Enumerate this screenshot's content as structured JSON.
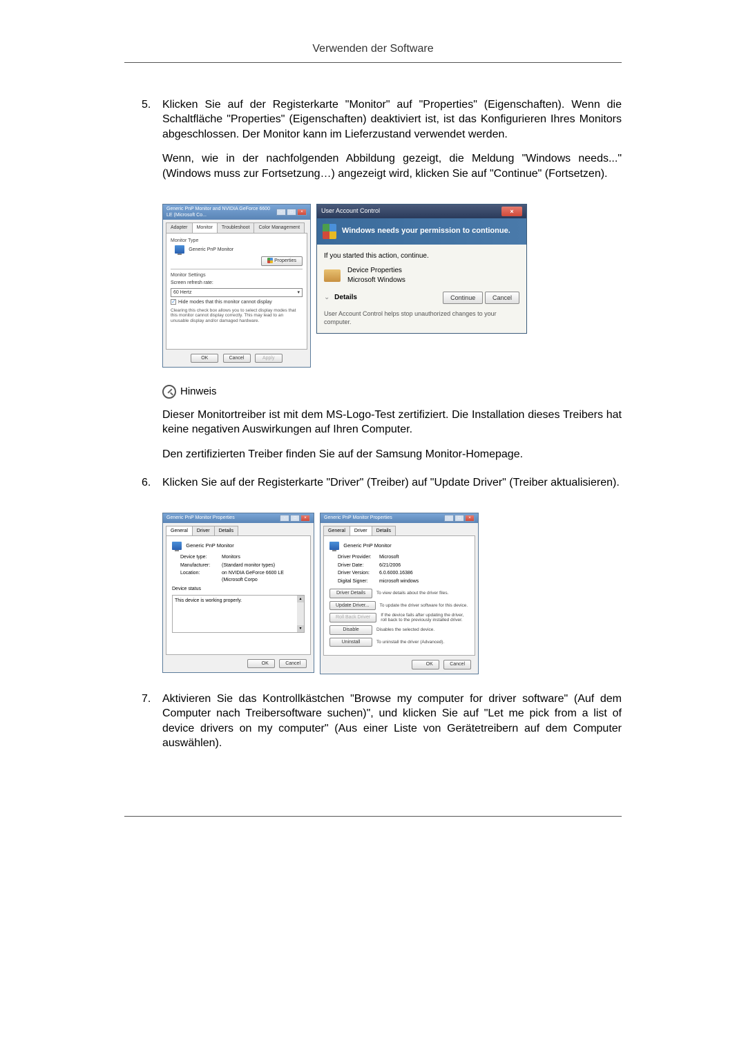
{
  "header": {
    "title": "Verwenden der Software"
  },
  "step5": {
    "number": "5.",
    "para1": "Klicken Sie auf der Registerkarte \"Monitor\" auf \"Properties\" (Eigenschaften). Wenn die Schaltfläche \"Properties\" (Eigenschaften) deaktiviert ist, ist das Konfigurieren Ihres Monitors abgeschlossen. Der Monitor kann im Lieferzustand verwendet werden.",
    "para2": "Wenn, wie in der nachfolgenden Abbildung gezeigt, die Meldung \"Windows needs...\" (Windows muss zur Fortsetzung…) angezeigt wird, klicken Sie auf \"Continue\" (Fortsetzen)."
  },
  "monitor_dialog": {
    "title": "Generic PnP Monitor and NVIDIA GeForce 6600 LE (Microsoft Co...",
    "tabs": {
      "adapter": "Adapter",
      "monitor": "Monitor",
      "troubleshoot": "Troubleshoot",
      "color": "Color Management"
    },
    "type_label": "Monitor Type",
    "type_value": "Generic PnP Monitor",
    "properties_btn": "Properties",
    "settings_label": "Monitor Settings",
    "refresh_label": "Screen refresh rate:",
    "refresh_value": "60 Hertz",
    "hide_modes": "Hide modes that this monitor cannot display",
    "hide_desc": "Clearing this check box allows you to select display modes that this monitor cannot display correctly. This may lead to an unusable display and/or damaged hardware.",
    "ok": "OK",
    "cancel": "Cancel",
    "apply": "Apply"
  },
  "uac": {
    "title": "User Account Control",
    "banner": "Windows needs your permission to contionue.",
    "subtext": "If you started this action, continue.",
    "prog_name": "Device Properties",
    "prog_pub": "Microsoft Windows",
    "details": "Details",
    "continue": "Continue",
    "cancel": "Cancel",
    "footer": "User Account Control helps stop unauthorized changes to your computer."
  },
  "note": {
    "title": "Hinweis",
    "para1": "Dieser Monitortreiber ist mit dem MS-Logo-Test zertifiziert. Die Installation dieses Treibers hat keine negativen Auswirkungen auf Ihren Computer.",
    "para2": "Den zertifizierten Treiber finden Sie auf der Samsung Monitor-Homepage."
  },
  "step6": {
    "number": "6.",
    "para1": "Klicken Sie auf der Registerkarte \"Driver\" (Treiber) auf \"Update Driver\" (Treiber aktualisieren)."
  },
  "gen_dialog": {
    "title": "Generic PnP Monitor Properties",
    "tabs": {
      "general": "General",
      "driver": "Driver",
      "details": "Details"
    },
    "name": "Generic PnP Monitor",
    "dtype_l": "Device type:",
    "dtype_v": "Monitors",
    "manu_l": "Manufacturer:",
    "manu_v": "(Standard monitor types)",
    "loc_l": "Location:",
    "loc_v": "on NVIDIA GeForce 6600 LE (Microsoft Corpo",
    "status_l": "Device status",
    "status_v": "This device is working properly.",
    "ok": "OK",
    "cancel": "Cancel"
  },
  "drv_dialog": {
    "title": "Generic PnP Monitor Properties",
    "name": "Generic PnP Monitor",
    "prov_l": "Driver Provider:",
    "prov_v": "Microsoft",
    "date_l": "Driver Date:",
    "date_v": "6/21/2006",
    "ver_l": "Driver Version:",
    "ver_v": "6.0.6000.16386",
    "sign_l": "Digital Signer:",
    "sign_v": "microsoft windows",
    "b_details": "Driver Details",
    "d_details": "To view details about the driver files.",
    "b_update": "Update Driver...",
    "d_update": "To update the driver software for this device.",
    "b_rollback": "Roll Back Driver",
    "d_rollback": "If the device fails after updating the driver, roll back to the previously installed driver.",
    "b_disable": "Disable",
    "d_disable": "Disables the selected device.",
    "b_uninstall": "Uninstall",
    "d_uninstall": "To uninstall the driver (Advanced).",
    "ok": "OK",
    "cancel": "Cancel"
  },
  "step7": {
    "number": "7.",
    "para1": "Aktivieren Sie das Kontrollkästchen \"Browse my computer for driver software\" (Auf dem Computer nach Treibersoftware suchen)\", und klicken Sie auf \"Let me pick from a list of device drivers on my computer\" (Aus einer Liste von Gerätetreibern auf dem Computer auswählen)."
  }
}
